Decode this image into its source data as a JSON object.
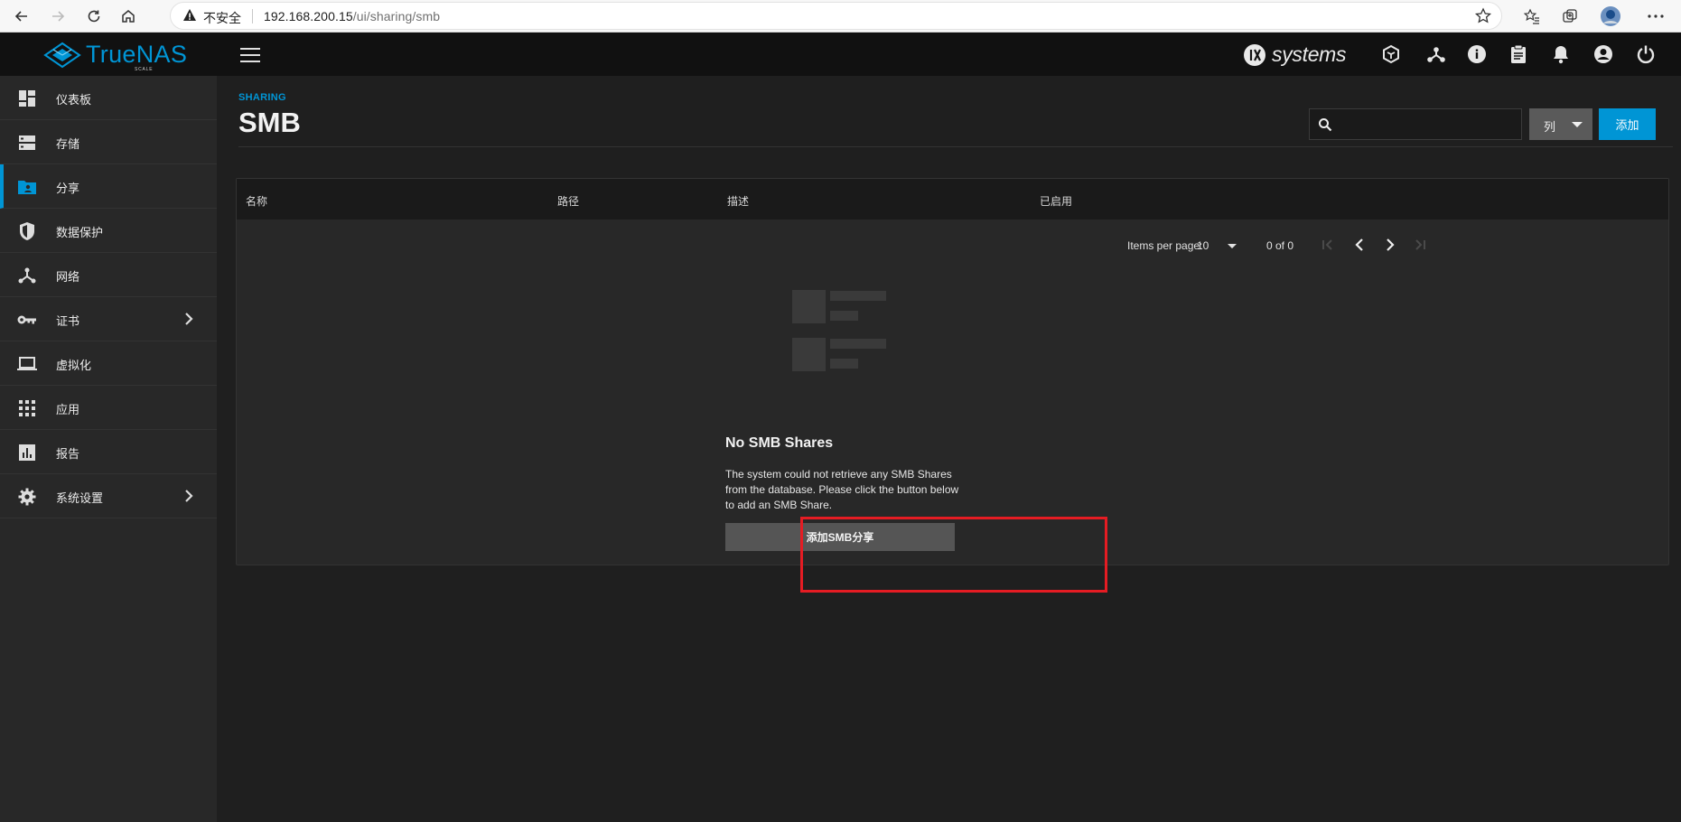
{
  "browser": {
    "insecure_label": "不安全",
    "url_host": "192.168.200.15",
    "url_path": "/ui/sharing/smb"
  },
  "topbar": {
    "logo_text": "TrueNAS",
    "logo_sub": "SCALE",
    "vendor_text": "systems"
  },
  "sidebar": {
    "items": [
      {
        "label": "仪表板",
        "icon": "dashboard-icon"
      },
      {
        "label": "存储",
        "icon": "storage-icon"
      },
      {
        "label": "分享",
        "icon": "folder-shared-icon"
      },
      {
        "label": "数据保护",
        "icon": "shield-icon"
      },
      {
        "label": "网络",
        "icon": "network-icon"
      },
      {
        "label": "证书",
        "icon": "key-icon"
      },
      {
        "label": "虚拟化",
        "icon": "laptop-icon"
      },
      {
        "label": "应用",
        "icon": "apps-grid-icon"
      },
      {
        "label": "报告",
        "icon": "report-chart-icon"
      },
      {
        "label": "系统设置",
        "icon": "gear-icon"
      }
    ],
    "active_index": 2
  },
  "page": {
    "breadcrumb": "SHARING",
    "title": "SMB",
    "columns_label": "列",
    "add_label": "添加"
  },
  "table": {
    "headers": [
      "名称",
      "路径",
      "描述",
      "已启用"
    ],
    "items_per_page_label": "Items per page:",
    "items_per_page_value": "10",
    "range_label": "0 of 0"
  },
  "empty": {
    "title": "No SMB Shares",
    "message": "The system could not retrieve any SMB Shares from the database. Please click the button below to add an SMB Share.",
    "button_label": "添加SMB分享"
  },
  "colors": {
    "accent": "#0095d5",
    "highlight": "#e51c23"
  }
}
